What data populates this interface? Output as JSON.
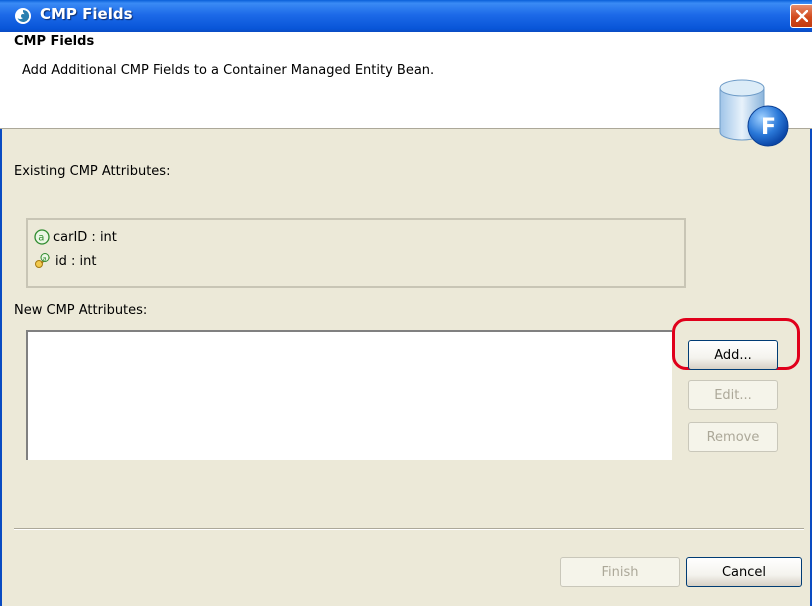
{
  "window": {
    "title": "CMP Fields",
    "icon": "eclipse-wizard-icon",
    "close_icon": "close-icon"
  },
  "header": {
    "title": "CMP Fields",
    "description": "Add Additional CMP Fields to a Container Managed Entity Bean.",
    "icon": "cmp-field-wizard-icon"
  },
  "existing": {
    "label": "Existing CMP Attributes:",
    "items": [
      {
        "text": "carID : int",
        "icon": "attribute-icon"
      },
      {
        "text": "id : int",
        "icon": "key-attribute-icon"
      }
    ]
  },
  "new_attrs": {
    "label": "New CMP Attributes:",
    "items": []
  },
  "buttons": {
    "add": "Add...",
    "edit": "Edit...",
    "remove": "Remove",
    "finish": "Finish",
    "cancel": "Cancel"
  },
  "colors": {
    "titlebar": "#0a5fd8",
    "highlight": "#e0001b",
    "dialog_bg": "#ece9d8"
  }
}
